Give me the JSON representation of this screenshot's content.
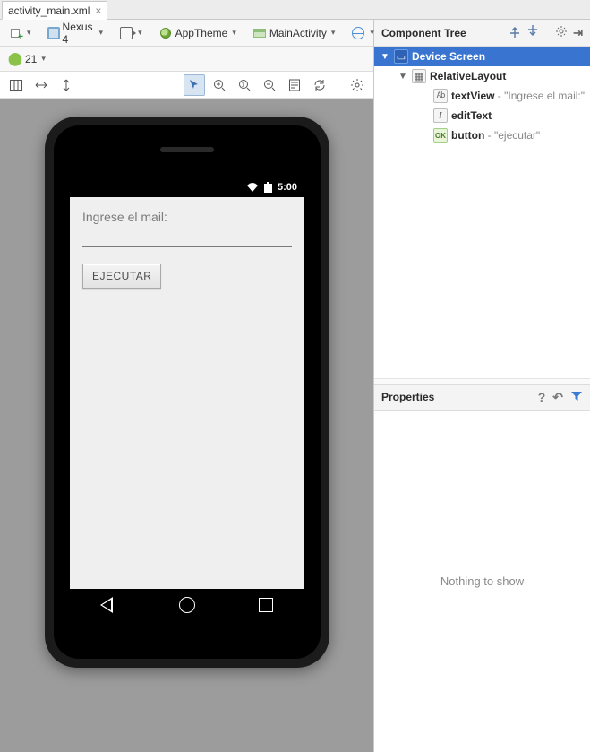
{
  "file_tab": {
    "name": "activity_main.xml",
    "close_glyph": "×"
  },
  "toolbar": {
    "device_label": "Nexus 4",
    "theme_label": "AppTheme",
    "activity_label": "MainActivity",
    "api_label": "21"
  },
  "preview": {
    "status_time": "5:00",
    "textview_text": "Ingrese el mail:",
    "button_text": "EJECUTAR"
  },
  "component_tree": {
    "title": "Component Tree",
    "root": {
      "label": "Device Screen"
    },
    "layout": {
      "label": "RelativeLayout"
    },
    "items": [
      {
        "id": "textView",
        "hint": " - \"Ingrese el mail:\"",
        "ico": "Ab"
      },
      {
        "id": "editText",
        "hint": "",
        "ico": "I"
      },
      {
        "id": "button",
        "hint": " - \"ejecutar\"",
        "ico": "OK"
      }
    ]
  },
  "properties": {
    "title": "Properties",
    "empty_text": "Nothing to show"
  },
  "glyphs": {
    "tri_down_white": "▼",
    "tri_down": "▼",
    "help": "?",
    "undo": "↶",
    "filter": "▼",
    "gear": "✶",
    "pin": "⇥",
    "wifi": "▲",
    "batt": "▮"
  }
}
